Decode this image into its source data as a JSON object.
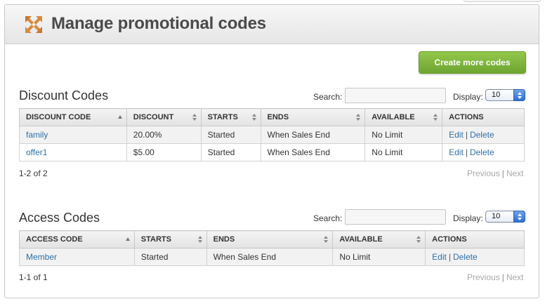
{
  "header": {
    "title": "Manage promotional codes",
    "logo_icon": "expand-arrows-icon"
  },
  "actions": {
    "create_label": "Create more codes"
  },
  "discount": {
    "title": "Discount Codes",
    "search_label": "Search:",
    "search_value": "",
    "display_label": "Display:",
    "display_value": "10",
    "columns": [
      "DISCOUNT CODE",
      "DISCOUNT",
      "STARTS",
      "ENDS",
      "AVAILABLE",
      "ACTIONS"
    ],
    "rows": [
      {
        "code": "family",
        "discount": "20.00%",
        "starts": "Started",
        "ends": "When Sales End",
        "available": "No Limit"
      },
      {
        "code": "offer1",
        "discount": "$5.00",
        "starts": "Started",
        "ends": "When Sales End",
        "available": "No Limit"
      }
    ],
    "count": "1-2 of 2",
    "previous": "Previous",
    "next": "Next",
    "separator": "|"
  },
  "access": {
    "title": "Access Codes",
    "search_label": "Search:",
    "search_value": "",
    "display_label": "Display:",
    "display_value": "10",
    "columns": [
      "ACCESS CODE",
      "STARTS",
      "ENDS",
      "AVAILABLE",
      "ACTIONS"
    ],
    "rows": [
      {
        "code": "Member",
        "starts": "Started",
        "ends": "When Sales End",
        "available": "No Limit"
      }
    ],
    "count": "1-1 of 1",
    "previous": "Previous",
    "next": "Next",
    "separator": "|"
  },
  "row_actions": {
    "edit": "Edit",
    "delete": "Delete",
    "separator": "|"
  },
  "colors": {
    "accent_green": "#7ab13a",
    "link": "#2f6fa8",
    "pager_disabled": "#a8a8a8"
  }
}
